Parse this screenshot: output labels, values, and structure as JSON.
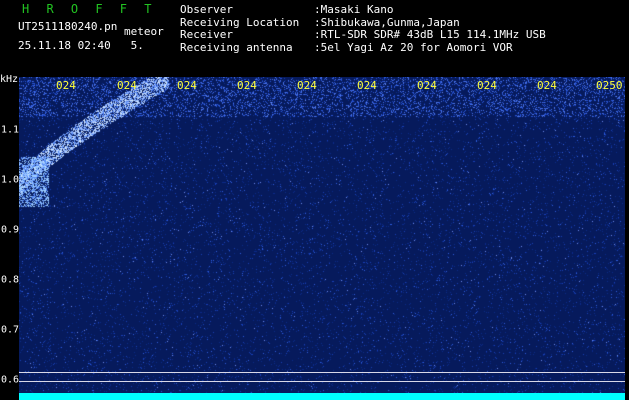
{
  "header": {
    "brand": "H R O F F T",
    "file_name": "UT2511180240.pn",
    "meteor_label": "meteor",
    "datetime": "25.11.18 02:40   5."
  },
  "meta": [
    {
      "key": "Observer",
      "value": ":Masaki Kano"
    },
    {
      "key": "Receiving Location",
      "value": ":Shibukawa,Gunma,Japan"
    },
    {
      "key": "Receiver",
      "value": ":RTL-SDR SDR# 43dB L15 114.1MHz USB"
    },
    {
      "key": "Receiving antenna",
      "value": ":5el Yagi Az 20 for Aomori VOR"
    }
  ],
  "axis": {
    "unit": "kHz",
    "y_ticks": [
      "1.1",
      "1.0",
      "0.9",
      "0.8",
      "0.7",
      "0.6"
    ],
    "x_ticks": [
      "024",
      "024",
      "024",
      "024",
      "024",
      "024",
      "024",
      "024",
      "024",
      "0250"
    ]
  },
  "colors": {
    "background": "#000000",
    "plot_background": "#061a5c",
    "brand_green": "#22c322",
    "time_label_yellow": "#ffff3a",
    "baseline_cyan": "#00ffff"
  }
}
